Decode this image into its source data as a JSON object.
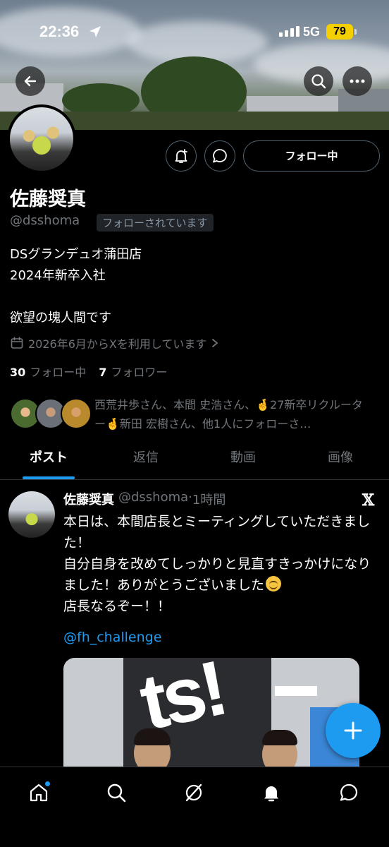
{
  "status_bar": {
    "time": "22:36",
    "network": "5G",
    "battery": "79"
  },
  "header": {
    "back_icon": "arrow-left-icon",
    "search_icon": "search-icon",
    "more_icon": "more-horizontal-icon"
  },
  "profile": {
    "name": "佐藤奨真",
    "handle": "@dsshoma",
    "follows_you": "フォローされています",
    "follow_button": "フォロー中",
    "bio": "DSグランデュオ蒲田店\n2024年新卒入社\n\n欲望の塊人間です",
    "joined": "2026年6月からXを利用しています",
    "following_count": "30",
    "following_label": "フォロー中",
    "followers_count": "7",
    "followers_label": "フォロワー",
    "mutuals_text": "西荒井歩さん、本間 史浩さん、🤞27新卒リクルーター🤞新田 宏樹さん、他1人にフォローさ…"
  },
  "tabs": [
    {
      "label": "ポスト"
    },
    {
      "label": "返信"
    },
    {
      "label": "動画"
    },
    {
      "label": "画像"
    }
  ],
  "post": {
    "author_name": "佐藤奨真",
    "author_handle": "@dsshoma",
    "separator": "·",
    "time": "1時間",
    "text_main": "本日は、本間店長とミーティングしていただきました！\n自分自身を改めてしっかりと見直すきっかけになりました！ありがとうございました",
    "text_end": "\n店長なるぞー！！",
    "mention": "@fh_challenge"
  },
  "colors": {
    "accent": "#1d9bf0",
    "muted": "#71767b",
    "background": "#000000",
    "battery": "#f5d000"
  }
}
